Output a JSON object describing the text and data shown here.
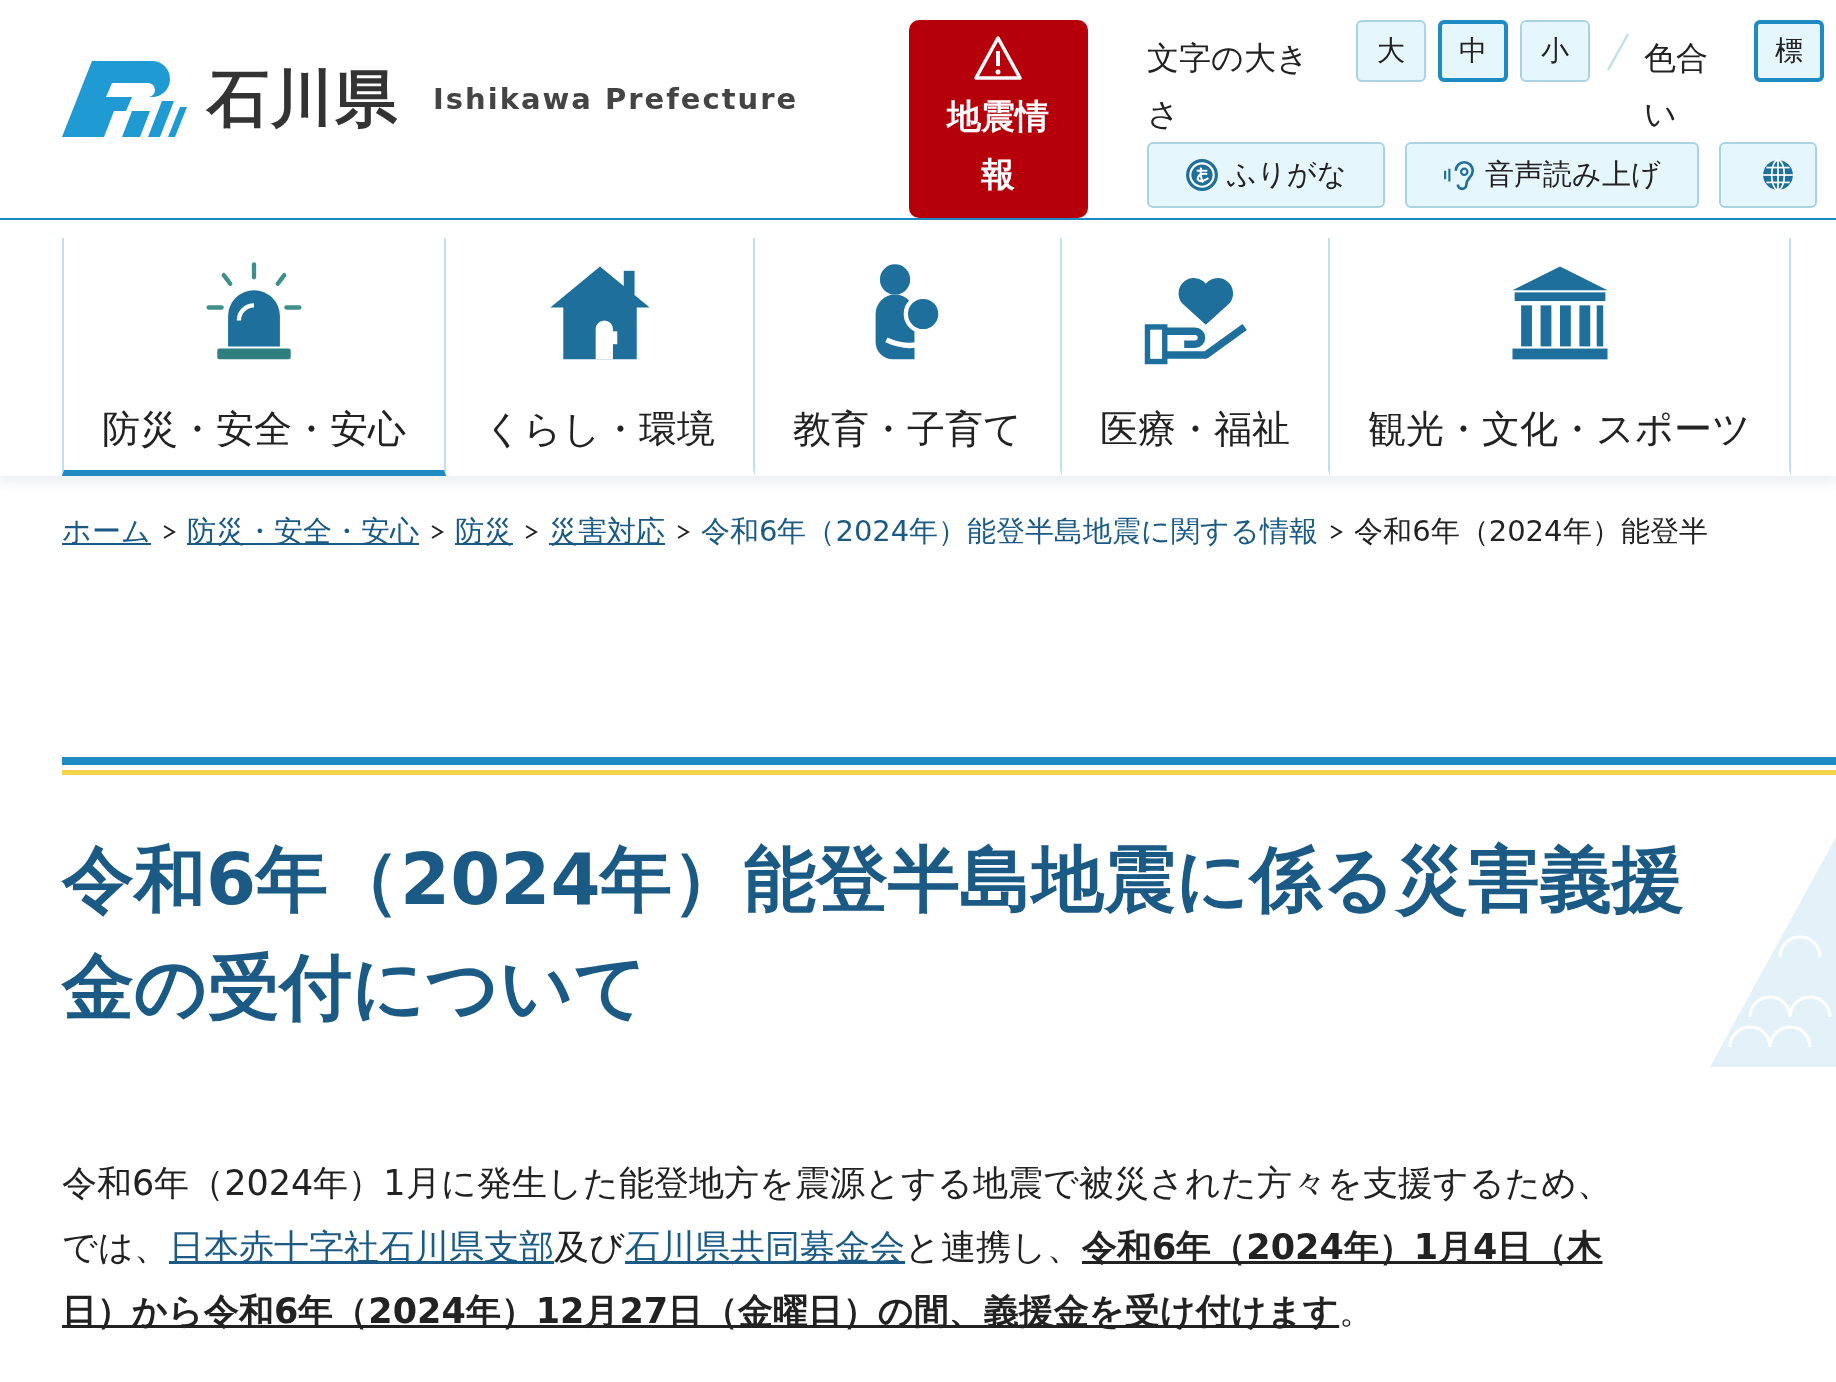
{
  "header": {
    "logo_text": "石川県",
    "logo_subtitle": "Ishikawa Prefecture",
    "alert_button": {
      "label": "地震情報"
    },
    "text_size": {
      "label": "文字の大きさ",
      "options": [
        {
          "label": "大",
          "selected": false
        },
        {
          "label": "中",
          "selected": true
        },
        {
          "label": "小",
          "selected": false
        }
      ]
    },
    "color_scheme": {
      "label": "色合い",
      "options": [
        {
          "label": "標",
          "selected": true
        }
      ]
    },
    "tools": [
      {
        "label": "ふりがな",
        "kind": "furigana"
      },
      {
        "label": "音声読み上げ",
        "kind": "speech"
      },
      {
        "kind": "language"
      }
    ]
  },
  "nav": [
    {
      "label": "防災・安全・安心",
      "kind": "siren",
      "selected": true
    },
    {
      "label": "くらし・環境",
      "kind": "house",
      "selected": false
    },
    {
      "label": "教育・子育て",
      "kind": "parent",
      "selected": false
    },
    {
      "label": "医療・福祉",
      "kind": "care",
      "selected": false
    },
    {
      "label": "観光・文化・スポーツ",
      "kind": "museum",
      "selected": false
    }
  ],
  "breadcrumb": [
    {
      "label": "ホーム",
      "kind": "link",
      "underlined": true
    },
    {
      "label": "防災・安全・安心",
      "kind": "link",
      "underlined": true
    },
    {
      "label": "防災",
      "kind": "link",
      "underlined": true
    },
    {
      "label": "災害対応",
      "kind": "link",
      "underlined": true
    },
    {
      "label": "令和6年（2024年）能登半島地震に関する情報",
      "kind": "link",
      "underlined": false
    },
    {
      "label": "令和6年（2024年）能登半",
      "kind": "current",
      "underlined": false
    }
  ],
  "title": "令和6年（2024年）能登半島地震に係る災害義援金の受付について",
  "intro_lines": [
    [
      {
        "text": "令和6年（2024年）1月に発生した能登地方を震源とする地震で被災された方々を支援するため、",
        "kind": "text"
      }
    ],
    [
      {
        "text": "では、",
        "kind": "text"
      },
      {
        "text": "日本赤十字社石川県支部",
        "kind": "link"
      },
      {
        "text": "及び",
        "kind": "text"
      },
      {
        "text": "石川県共同募金会",
        "kind": "link"
      },
      {
        "text": "と連携し、",
        "kind": "text"
      },
      {
        "text": "令和6年（2024年）1月4日（木",
        "kind": "emphasis"
      }
    ],
    [
      {
        "text": "日）から令和6年（2024年）12月27日（金曜日）の間、義援金を受け付けます",
        "kind": "emphasis"
      },
      {
        "text": "。",
        "kind": "text"
      }
    ]
  ]
}
